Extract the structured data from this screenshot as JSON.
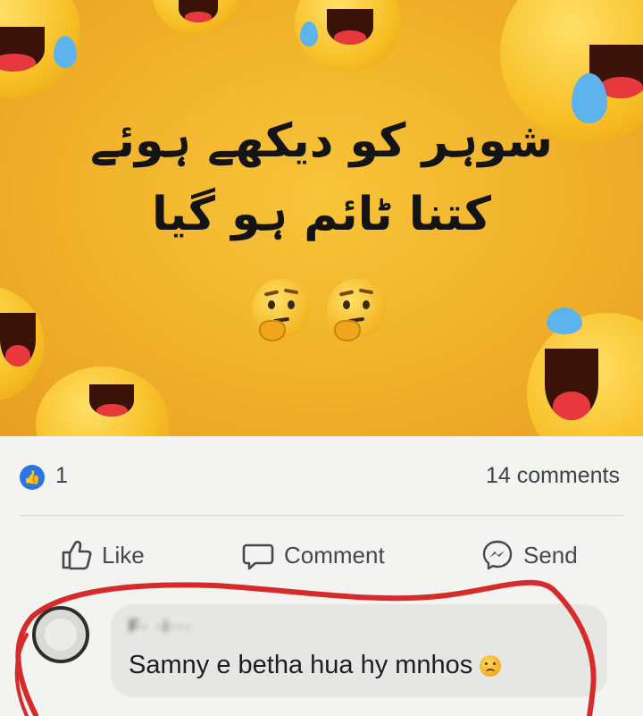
{
  "meme": {
    "line1": "شوہر کو دیکھے ہوئے",
    "line2": "کتنا ٹائم ہو گیا"
  },
  "post": {
    "likes": "1",
    "comments_count": "14 comments"
  },
  "actions": {
    "like": "Like",
    "comment": "Comment",
    "send": "Send"
  },
  "comment": {
    "author": "F· ·i···",
    "text": "Samny e betha hua hy mnhos"
  },
  "colors": {
    "fb_blue": "#2a73e8",
    "meme_yellow": "#f0b12a",
    "annotation_red": "#d62b2b"
  },
  "icons": {
    "like_badge": "thumbs-up-icon",
    "like_action": "thumbs-up-outline-icon",
    "comment_action": "speech-bubble-icon",
    "send_action": "messenger-icon",
    "comment_emoji": "frowning-face-icon"
  }
}
